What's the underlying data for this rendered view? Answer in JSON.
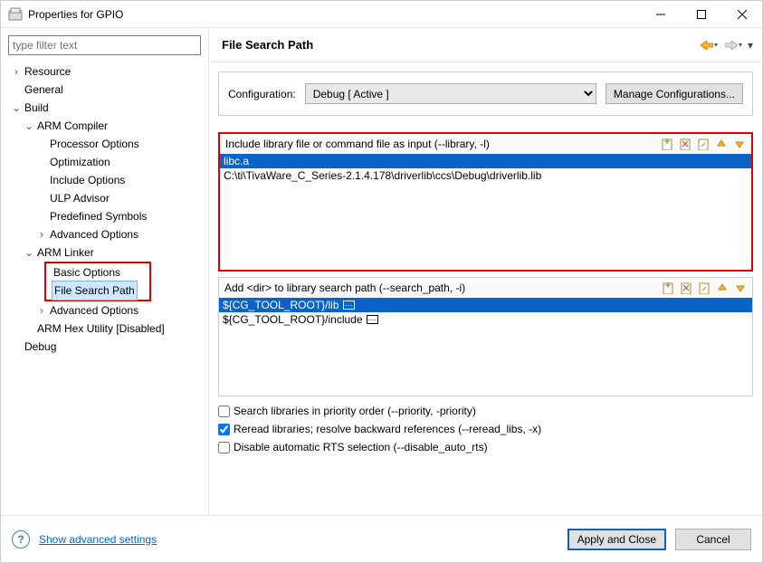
{
  "window": {
    "title": "Properties for GPIO"
  },
  "filter": {
    "placeholder": "type filter text"
  },
  "tree": {
    "resource": "Resource",
    "general": "General",
    "build": "Build",
    "arm_compiler": "ARM Compiler",
    "processor_options": "Processor Options",
    "optimization": "Optimization",
    "include_options": "Include Options",
    "ulp_advisor": "ULP Advisor",
    "predefined_symbols": "Predefined Symbols",
    "advanced_options_compiler": "Advanced Options",
    "arm_linker": "ARM Linker",
    "basic_options": "Basic Options",
    "file_search_path": "File Search Path",
    "advanced_options_linker": "Advanced Options",
    "arm_hex": "ARM Hex Utility  [Disabled]",
    "debug": "Debug"
  },
  "right": {
    "title": "File Search Path",
    "config_label": "Configuration:",
    "config_value": "Debug  [ Active ]",
    "manage_btn": "Manage Configurations..."
  },
  "panel1": {
    "title": "Include library file or command file as input (--library, -l)",
    "items": [
      "libc.a",
      "C:\\ti\\TivaWare_C_Series-2.1.4.178\\driverlib\\ccs\\Debug\\driverlib.lib"
    ]
  },
  "panel2": {
    "title": "Add <dir> to library search path (--search_path, -i)",
    "items": [
      "${CG_TOOL_ROOT}/lib",
      "${CG_TOOL_ROOT}/include"
    ]
  },
  "checks": {
    "priority": "Search libraries in priority order (--priority, -priority)",
    "reread": "Reread libraries; resolve backward references (--reread_libs, -x)",
    "disable_rts": "Disable automatic RTS selection (--disable_auto_rts)"
  },
  "footer": {
    "advanced": "Show advanced settings",
    "apply": "Apply and Close",
    "cancel": "Cancel"
  }
}
